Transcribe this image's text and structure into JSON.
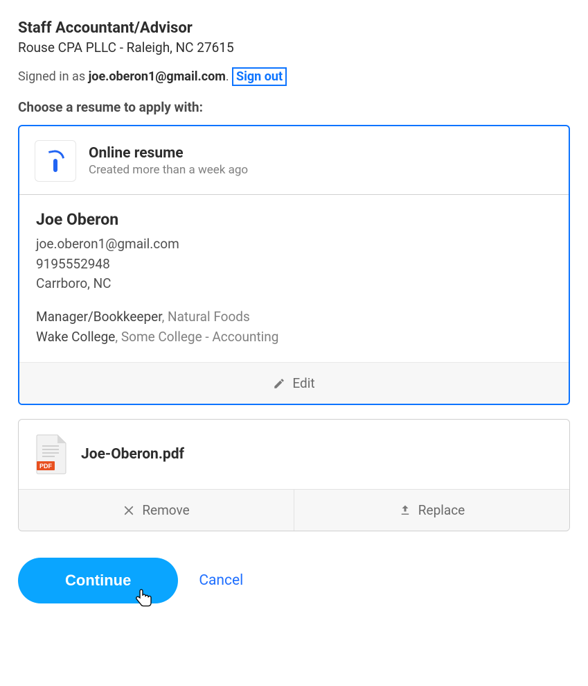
{
  "job": {
    "title": "Staff Accountant/Advisor",
    "company_location": "Rouse CPA PLLC - Raleigh, NC 27615"
  },
  "auth": {
    "signed_in_prefix": "Signed in as ",
    "email": "joe.oberon1@gmail.com",
    "period": ". ",
    "sign_out_label": "Sign out"
  },
  "choose_label": "Choose a resume to apply with:",
  "online_resume": {
    "title": "Online resume",
    "subtitle": "Created more than a week ago",
    "name": "Joe Oberon",
    "email": "joe.oberon1@gmail.com",
    "phone": "9195552948",
    "location": "Carrboro, NC",
    "experience": {
      "role": "Manager/Bookkeeper",
      "sep1": ", ",
      "company": "Natural Foods"
    },
    "education": {
      "school": "Wake College",
      "sep2": ", ",
      "degree": "Some College - Accounting"
    },
    "edit_label": "Edit"
  },
  "pdf_resume": {
    "filename": "Joe-Oberon.pdf",
    "remove_label": "Remove",
    "replace_label": "Replace"
  },
  "buttons": {
    "continue": "Continue",
    "cancel": "Cancel"
  }
}
